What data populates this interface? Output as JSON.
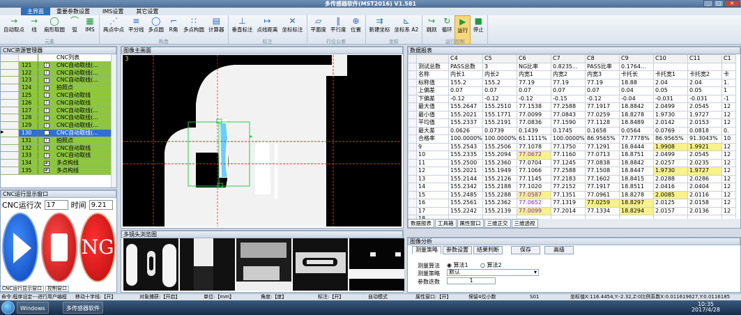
{
  "window": {
    "title": "多传感器软件(MST2016) V1.581"
  },
  "menu": [
    "主界面",
    "重要参数设置",
    "IMS设置",
    "其它设置"
  ],
  "ribbon": {
    "groups": [
      {
        "label": "元素",
        "tools": [
          {
            "label": "自动取点",
            "icon": "→"
          },
          {
            "label": "线",
            "icon": "→"
          },
          {
            "label": "扇形取圆",
            "icon": "◯"
          },
          {
            "label": "弧",
            "icon": "⌒"
          },
          {
            "label": "IMS",
            "icon": "▦"
          }
        ]
      },
      {
        "label": "构造",
        "tools": [
          {
            "label": "两点中点",
            "icon": "⋰"
          },
          {
            "label": "平分线",
            "icon": "≡"
          },
          {
            "label": "多点圆",
            "icon": "◯"
          },
          {
            "label": "R角",
            "icon": "⌐"
          },
          {
            "label": "多点构圆",
            "icon": "∷"
          },
          {
            "label": "计算器",
            "icon": "▤"
          }
        ]
      },
      {
        "label": "标注",
        "tools": [
          {
            "label": "垂直标注",
            "icon": "⊥"
          },
          {
            "label": "点线距离",
            "icon": "↦"
          },
          {
            "label": "坐标标注",
            "icon": "✕"
          }
        ]
      },
      {
        "label": "行位公差",
        "tools": [
          {
            "label": "平面度",
            "icon": "▱"
          },
          {
            "label": "平行度",
            "icon": "∥"
          },
          {
            "label": "位置",
            "icon": "⊕"
          }
        ]
      },
      {
        "label": "坐标",
        "tools": [
          {
            "label": "新建坐标",
            "icon": "⇉"
          },
          {
            "label": "坐标系  A2",
            "icon": "⊾"
          }
        ]
      },
      {
        "label": "运行控制",
        "tools": [
          {
            "label": "跳跃",
            "icon": "↪"
          },
          {
            "label": "循环",
            "icon": "↻"
          },
          {
            "label": "运行",
            "icon": "▶"
          },
          {
            "label": "停止",
            "icon": "■"
          }
        ]
      }
    ]
  },
  "cnc": {
    "title": "CNC资源管理器",
    "column": "CNC列表",
    "items": [
      {
        "num": "121",
        "name": "CNC自动取线(..."
      },
      {
        "num": "122",
        "name": "CNC自动取线(..."
      },
      {
        "num": "123",
        "name": "CNC自动取线(..."
      },
      {
        "num": "124",
        "name": "拍照点"
      },
      {
        "num": "125",
        "name": "CNC自动取线"
      },
      {
        "num": "126",
        "name": "CNC自动取线"
      },
      {
        "num": "127",
        "name": "CNC自动取线(..."
      },
      {
        "num": "128",
        "name": "CNC自动取线(..."
      },
      {
        "num": "129",
        "name": "CNC自动取线(..."
      },
      {
        "num": "130",
        "name": "CNC自动取线(..."
      },
      {
        "num": "131",
        "name": "拍照点"
      },
      {
        "num": "132",
        "name": "CNC自动取线"
      },
      {
        "num": "133",
        "name": "CNC自动取线"
      },
      {
        "num": "134",
        "name": "多点构线"
      },
      {
        "num": "135",
        "name": "多点构线"
      }
    ],
    "selected": "130"
  },
  "run": {
    "title": "CNC运行显示窗口",
    "label_run": "CNC运行次",
    "count": "17",
    "label_time": "时间",
    "time": "9.21",
    "ng_label": "NG"
  },
  "bottom_tabs": [
    "CNC运行显示窗口",
    "控制窗口"
  ],
  "image": {
    "title": "图像主画面",
    "index": "3"
  },
  "multi": {
    "title": "多镜头浏览图"
  },
  "report": {
    "title": "数据报表",
    "columns": [
      "",
      "C4",
      "C5",
      "C6",
      "C7",
      "C8",
      "C9",
      "C10",
      "C11",
      "C1"
    ],
    "rows": [
      [
        "测试总数",
        "PASS总数",
        "3",
        "NG比率",
        "0.8235...",
        "PASS比率",
        "0.1764...",
        "",
        "",
        ""
      ],
      [
        "名称",
        "内长1",
        "内长2",
        "内宽1",
        "内宽2",
        "内宽3",
        "卡托长",
        "卡托宽1",
        "卡托宽2",
        "卡"
      ],
      [
        "标称值",
        "155.2",
        "155.2",
        "77.19",
        "77.19",
        "77.19",
        "18.88",
        "2.04",
        "2.04",
        "1."
      ],
      [
        "上偏差",
        "0.07",
        "0.07",
        "0.07",
        "0.07",
        "0.07",
        "0.04",
        "0.05",
        "0.05",
        "1"
      ],
      [
        "下偏差",
        "-0.12",
        "-0.12",
        "-0.12",
        "-0.15",
        "-0.12",
        "-0.04",
        "-0.031",
        "-0.031",
        "-1"
      ],
      [
        "最大值",
        "155.2647",
        "155.2510",
        "77.1538",
        "77.2588",
        "77.1917",
        "18.8842",
        "2.0499",
        "2.0545",
        "12"
      ],
      [
        "最小值",
        "155.2021",
        "155.1771",
        "77.0099",
        "77.0843",
        "77.0259",
        "18.8278",
        "1.9730",
        "1.9727",
        "12"
      ],
      [
        "平均值",
        "155.2337",
        "155.2191",
        "77.0836",
        "77.1590",
        "77.1128",
        "18.8489",
        "2.0142",
        "2.0153",
        "12"
      ],
      [
        "最大差",
        "0.0626",
        "0.0739",
        "0.1439",
        "0.1745",
        "0.1658",
        "0.0564",
        "0.0769",
        "0.0818",
        "0."
      ],
      [
        "合格率",
        "100.0000%",
        "100.0000%",
        "61.1111%",
        "100.0000%",
        "86.9565%",
        "77.7778%",
        "86.9565%",
        "91.3043%",
        "10"
      ],
      [
        "9",
        "155.2543",
        "155.2506",
        "77.1078",
        "77.1750",
        "77.1291",
        "18.8444",
        "1.9908",
        "1.9921",
        "12"
      ],
      [
        "10",
        "155.2335",
        "155.2094",
        "77.0672",
        "77.1160",
        "77.0713",
        "18.8751",
        "2.0499",
        "2.0545",
        "12"
      ],
      [
        "11",
        "155.2500",
        "155.2360",
        "77.0704",
        "77.1245",
        "77.0838",
        "18.8842",
        "2.0257",
        "2.0235",
        "12"
      ],
      [
        "12",
        "155.2021",
        "155.1949",
        "77.1066",
        "77.2588",
        "77.1508",
        "18.8447",
        "1.9730",
        "1.9727",
        "12"
      ],
      [
        "13",
        "155.2144",
        "155.2126",
        "77.1145",
        "77.2183",
        "77.1602",
        "18.8415",
        "2.0288",
        "2.0286",
        "12"
      ],
      [
        "14",
        "155.2342",
        "155.2188",
        "77.1020",
        "77.2152",
        "77.1917",
        "18.8511",
        "2.0416",
        "2.0404",
        "12"
      ],
      [
        "15",
        "155.2485",
        "155.2288",
        "77.0587",
        "77.1351",
        "77.0961",
        "18.8278",
        "2.0085",
        "2.0116",
        "12"
      ],
      [
        "16",
        "155.2561",
        "155.2362",
        "77.0652",
        "77.1319",
        "77.0259",
        "18.8297",
        "2.0125",
        "2.0158",
        "12"
      ],
      [
        "17",
        "155.2242",
        "155.2139",
        "77.0099",
        "77.2014",
        "77.1334",
        "18.8294",
        "2.0157",
        "2.0136",
        "12"
      ],
      [
        "18",
        "",
        "",
        "",
        "",
        "",
        "",
        "",
        "",
        ""
      ]
    ],
    "tabs": [
      "数据报表",
      "工具箱",
      "属性窗口",
      "三维正交",
      "三维透视"
    ]
  },
  "analysis": {
    "title": "图像分析",
    "tabs": [
      "测量策略",
      "参数设置",
      "结果判断",
      "保存",
      "高级"
    ],
    "algo_label": "测量算法",
    "algo1": "算法1",
    "algo2": "算法2",
    "strategy_label": "测量策略",
    "strategy_value": "默认",
    "iter_label": "参数迭数",
    "iter_value": "1"
  },
  "status": {
    "s1": "命令:程序设定---进行用户编程",
    "s2": "移动十字线:【开】",
    "s3": "对象捕获:【开启】",
    "s4": "单位:【mm】",
    "s5": "角度:【度】",
    "s6": "标注:【开】",
    "s7": "自动模式",
    "s8": "属性窗口:【开】",
    "s9": "保留4位小数",
    "s10": "S01",
    "s11": "坐标值X:116.4454,Y:-2.32,Z:0比例系数X:0.011619627,Y:0.0116185"
  },
  "taskbar": {
    "items": [
      "Windows",
      "多传感器软件"
    ],
    "time": "10:35",
    "date": "2017/4/28"
  }
}
